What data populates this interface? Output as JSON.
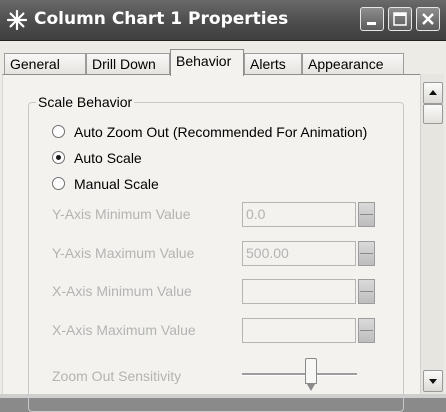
{
  "window": {
    "title": "Column Chart 1 Properties",
    "app_icon": "asterisk-star-icon",
    "controls": [
      "minimize-icon",
      "maximize-icon",
      "close-icon"
    ]
  },
  "tabs": [
    {
      "label": "General",
      "active": false
    },
    {
      "label": "Drill Down",
      "active": false
    },
    {
      "label": "Behavior",
      "active": true
    },
    {
      "label": "Alerts",
      "active": false
    },
    {
      "label": "Appearance",
      "active": false
    }
  ],
  "scale_behavior": {
    "legend": "Scale Behavior",
    "options": [
      {
        "label": "Auto Zoom Out  (Recommended For Animation)",
        "checked": false
      },
      {
        "label": "Auto Scale",
        "checked": true
      },
      {
        "label": "Manual Scale",
        "checked": false
      }
    ],
    "fields": [
      {
        "label": "Y-Axis Minimum Value",
        "value": "0.0"
      },
      {
        "label": "Y-Axis Maximum Value",
        "value": "500.00"
      },
      {
        "label": "X-Axis Minimum Value",
        "value": ""
      },
      {
        "label": "X-Axis Maximum Value",
        "value": ""
      }
    ],
    "zoom_sensitivity": {
      "label": "Zoom Out Sensitivity",
      "level_fraction": 0.6
    }
  },
  "colors": {
    "titlebar": "#4f4f4f",
    "panel": "#f3f2ee",
    "disabled_text": "#b3b3b3"
  }
}
